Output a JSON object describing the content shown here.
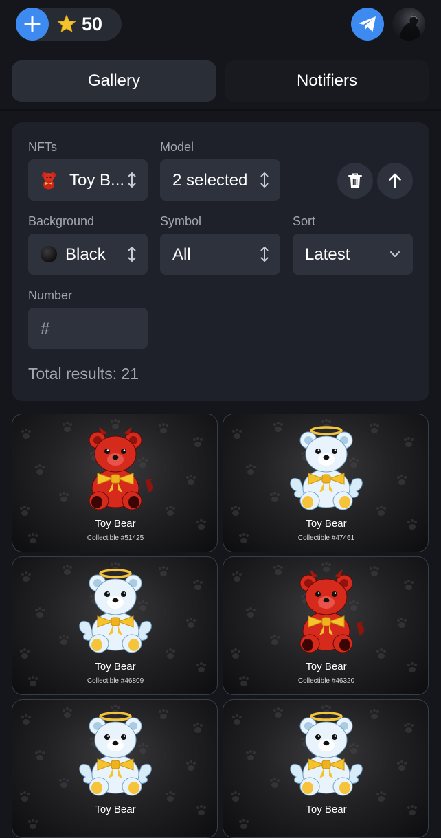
{
  "header": {
    "balance": "50",
    "add_icon": "plus-icon",
    "star_icon": "star-icon",
    "telegram_icon": "telegram-icon",
    "colors": {
      "accent": "#3d8bf0",
      "star": "#f5c32c"
    }
  },
  "tabs": [
    {
      "label": "Gallery",
      "active": true
    },
    {
      "label": "Notifiers",
      "active": false
    }
  ],
  "filters": {
    "nfts": {
      "label": "NFTs",
      "value": "Toy B..."
    },
    "model": {
      "label": "Model",
      "value": "2 selected"
    },
    "background": {
      "label": "Background",
      "value": "Black"
    },
    "symbol": {
      "label": "Symbol",
      "value": "All"
    },
    "sort": {
      "label": "Sort",
      "value": "Latest"
    },
    "number": {
      "label": "Number",
      "placeholder": "#"
    },
    "delete_icon": "trash-icon",
    "sort_direction_icon": "arrow-up-icon",
    "total": "Total results: 21"
  },
  "items": [
    {
      "name": "Toy Bear",
      "number": "Collectible #51425",
      "model": "devil"
    },
    {
      "name": "Toy Bear",
      "number": "Collectible #47461",
      "model": "angel"
    },
    {
      "name": "Toy Bear",
      "number": "Collectible #46809",
      "model": "angel"
    },
    {
      "name": "Toy Bear",
      "number": "Collectible #46320",
      "model": "devil"
    },
    {
      "name": "Toy Bear",
      "number": "",
      "model": "angel"
    },
    {
      "name": "Toy Bear",
      "number": "",
      "model": "angel"
    }
  ]
}
